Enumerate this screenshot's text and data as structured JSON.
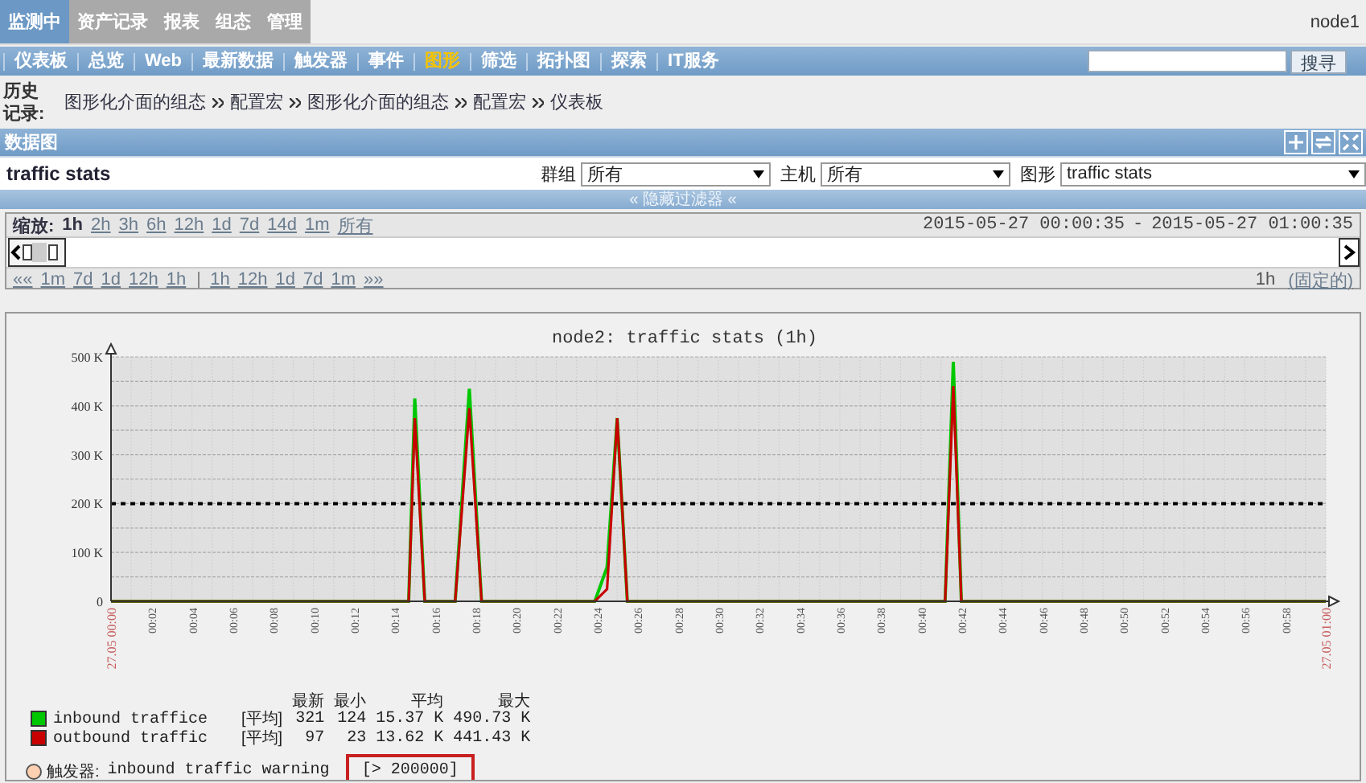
{
  "top_tabs": [
    {
      "label": "监测中",
      "selected": true
    },
    {
      "label": "资产记录",
      "selected": false
    },
    {
      "label": "报表",
      "selected": false
    },
    {
      "label": "组态",
      "selected": false
    },
    {
      "label": "管理",
      "selected": false
    }
  ],
  "user": "node1",
  "nav": [
    {
      "label": "仪表板",
      "selected": false
    },
    {
      "label": "总览",
      "selected": false
    },
    {
      "label": "Web",
      "selected": false
    },
    {
      "label": "最新数据",
      "selected": false
    },
    {
      "label": "触发器",
      "selected": false
    },
    {
      "label": "事件",
      "selected": false
    },
    {
      "label": "图形",
      "selected": true
    },
    {
      "label": "筛选",
      "selected": false
    },
    {
      "label": "拓扑图",
      "selected": false
    },
    {
      "label": "探索",
      "selected": false
    },
    {
      "label": "IT服务",
      "selected": false
    }
  ],
  "search": {
    "button": "搜寻"
  },
  "history": {
    "label": "历史记录:",
    "items": [
      "图形化介面的组态",
      "配置宏",
      "图形化介面的组态",
      "配置宏",
      "仪表板"
    ]
  },
  "section": {
    "title": "数据图"
  },
  "filter": {
    "title": "traffic stats",
    "fields": [
      {
        "label": "群组",
        "value": "所有",
        "kind": "short"
      },
      {
        "label": "主机",
        "value": "所有",
        "kind": "short"
      },
      {
        "label": "图形",
        "value": "traffic stats",
        "kind": "wide"
      }
    ],
    "toggle": "« 隐藏过滤器 «"
  },
  "timeline": {
    "zoom_label": "缩放:",
    "zoom_options": [
      {
        "label": "1h",
        "selected": true
      },
      {
        "label": "2h",
        "selected": false
      },
      {
        "label": "3h",
        "selected": false
      },
      {
        "label": "6h",
        "selected": false
      },
      {
        "label": "12h",
        "selected": false
      },
      {
        "label": "1d",
        "selected": false
      },
      {
        "label": "7d",
        "selected": false
      },
      {
        "label": "14d",
        "selected": false
      },
      {
        "label": "1m",
        "selected": false
      },
      {
        "label": "所有",
        "selected": false
      }
    ],
    "start": "2015-05-27 00:00:35",
    "separator": "-",
    "end": "2015-05-27 01:00:35",
    "back": [
      "««",
      "1m",
      "7d",
      "1d",
      "12h",
      "1h"
    ],
    "forward": [
      "1h",
      "12h",
      "1d",
      "7d",
      "1m",
      "»»"
    ],
    "period": "1h",
    "fixed": "(固定的)"
  },
  "graph": {
    "chart_data": {
      "type": "line",
      "title": "node2: traffic stats (1h)",
      "x": [
        0,
        14.7,
        15,
        15.5,
        17,
        17.7,
        18.3,
        23.9,
        24.5,
        25,
        25.5,
        41.2,
        41.6,
        42,
        60
      ],
      "series": [
        {
          "name": "inbound traffice",
          "color": "#00c800",
          "values": [
            0,
            0,
            415000,
            0,
            0,
            435000,
            0,
            0,
            70000,
            375000,
            0,
            0,
            490000,
            0,
            0
          ]
        },
        {
          "name": "outbound traffic",
          "color": "#c80000",
          "values": [
            0,
            0,
            375000,
            0,
            0,
            395000,
            0,
            0,
            25000,
            375000,
            0,
            0,
            440000,
            0,
            0
          ]
        }
      ],
      "xlim": [
        0,
        60
      ],
      "ylim": [
        0,
        500000
      ],
      "xticks": [
        {
          "value": 0,
          "label": "27.05 00:00"
        },
        {
          "value": 2,
          "label": "00:02"
        },
        {
          "value": 4,
          "label": "00:04"
        },
        {
          "value": 6,
          "label": "00:06"
        },
        {
          "value": 8,
          "label": "00:08"
        },
        {
          "value": 10,
          "label": "00:10"
        },
        {
          "value": 12,
          "label": "00:12"
        },
        {
          "value": 14,
          "label": "00:14"
        },
        {
          "value": 16,
          "label": "00:16"
        },
        {
          "value": 18,
          "label": "00:18"
        },
        {
          "value": 20,
          "label": "00:20"
        },
        {
          "value": 22,
          "label": "00:22"
        },
        {
          "value": 24,
          "label": "00:24"
        },
        {
          "value": 26,
          "label": "00:26"
        },
        {
          "value": 28,
          "label": "00:28"
        },
        {
          "value": 30,
          "label": "00:30"
        },
        {
          "value": 32,
          "label": "00:32"
        },
        {
          "value": 34,
          "label": "00:34"
        },
        {
          "value": 36,
          "label": "00:36"
        },
        {
          "value": 38,
          "label": "00:38"
        },
        {
          "value": 40,
          "label": "00:40"
        },
        {
          "value": 42,
          "label": "00:42"
        },
        {
          "value": 44,
          "label": "00:44"
        },
        {
          "value": 46,
          "label": "00:46"
        },
        {
          "value": 48,
          "label": "00:48"
        },
        {
          "value": 50,
          "label": "00:50"
        },
        {
          "value": 52,
          "label": "00:52"
        },
        {
          "value": 54,
          "label": "00:54"
        },
        {
          "value": 56,
          "label": "00:56"
        },
        {
          "value": 58,
          "label": "00:58"
        },
        {
          "value": 60,
          "label": "27.05 01:00"
        }
      ],
      "yticks": [
        {
          "value": 0,
          "label": "0"
        },
        {
          "value": 100000,
          "label": "100 K"
        },
        {
          "value": 200000,
          "label": "200 K"
        },
        {
          "value": 300000,
          "label": "300 K"
        },
        {
          "value": 400000,
          "label": "400 K"
        },
        {
          "value": 500000,
          "label": "500 K"
        }
      ],
      "grid": true,
      "ref_lines": [
        {
          "axis": "y",
          "value": 200000
        }
      ]
    },
    "legend": {
      "headers": [
        "最新",
        "最小",
        "平均",
        "最大"
      ],
      "items": [
        {
          "function": "[平均]",
          "values": [
            "321",
            "124",
            "15.37 K",
            "490.73 K"
          ]
        },
        {
          "function": "[平均]",
          "values": [
            "97",
            "23",
            "13.62 K",
            "441.43 K"
          ]
        }
      ],
      "trigger": {
        "label": "触发器:",
        "name": "inbound traffic warning",
        "condition": "[> 200000]"
      }
    }
  }
}
